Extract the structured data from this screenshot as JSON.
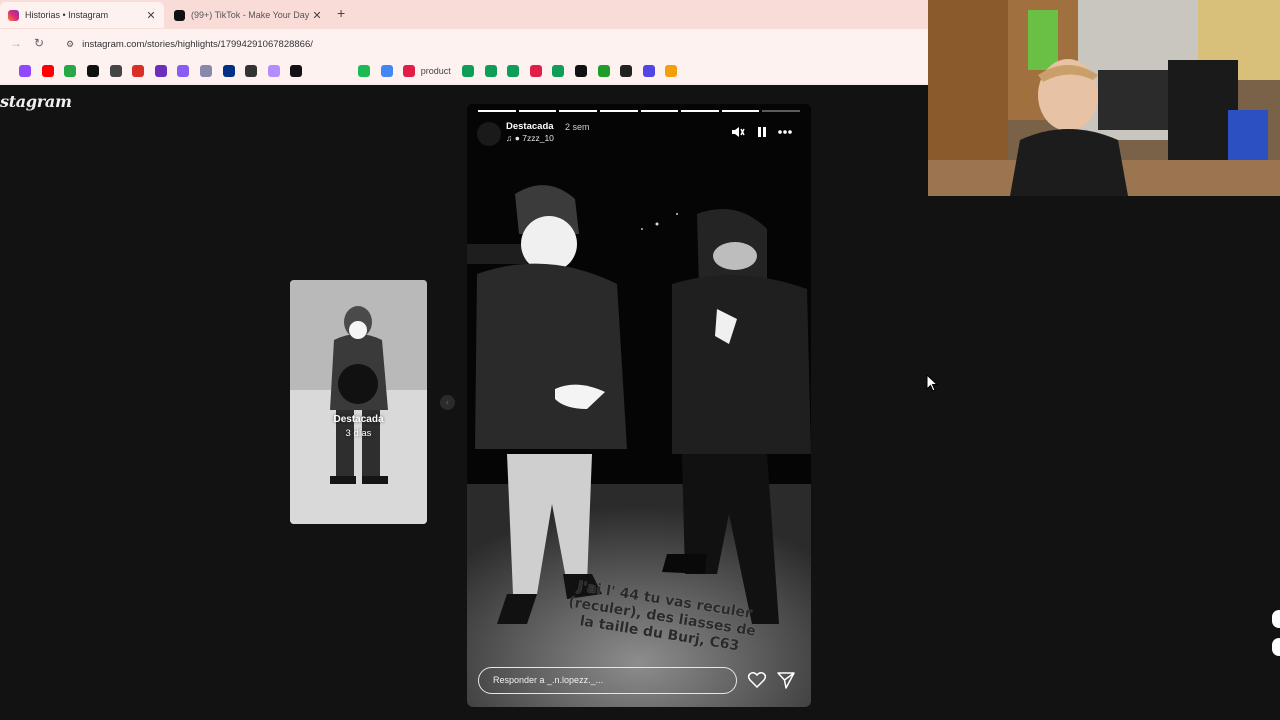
{
  "browser": {
    "tabs": [
      {
        "title": "Historias • Instagram",
        "favicon_color": "#e1306c",
        "active": true
      },
      {
        "title": "(99+) TikTok - Make Your Day",
        "favicon_color": "#111111",
        "active": false
      }
    ],
    "new_tab_icon": "plus-icon",
    "url": "instagram.com/stories/highlights/17994291067828866/",
    "bookmarks": [
      {
        "icon": "twitch",
        "color": "#9146ff"
      },
      {
        "icon": "youtube",
        "color": "#ff0000"
      },
      {
        "icon": "green-app",
        "color": "#28a745"
      },
      {
        "icon": "tiktok",
        "color": "#111111"
      },
      {
        "icon": "chatgpt",
        "color": "#444444"
      },
      {
        "icon": "gmail",
        "color": "#d93025"
      },
      {
        "icon": "purple-app",
        "color": "#6f2dbd"
      },
      {
        "icon": "rainbow-app",
        "color": "#8a5cf6"
      },
      {
        "icon": "box-app",
        "color": "#8888aa"
      },
      {
        "icon": "paypal",
        "color": "#003087"
      },
      {
        "icon": "whatsapp",
        "color": "#333333"
      },
      {
        "icon": "triangle-app",
        "color": "#b38cff"
      },
      {
        "icon": "dot-app",
        "color": "#111111"
      },
      {
        "icon": "spacer",
        "color": "#fdf2f0"
      },
      {
        "icon": "spacer",
        "color": "#fdf2f0"
      },
      {
        "icon": "spotify",
        "color": "#1db954"
      },
      {
        "icon": "play-app",
        "color": "#4285f4"
      },
      {
        "icon": "c-app",
        "color": "#e11d48"
      }
    ],
    "bookmark_label": "product",
    "bookmarks_after": [
      {
        "icon": "sheet",
        "color": "#0f9d58"
      },
      {
        "icon": "sheet",
        "color": "#0f9d58"
      },
      {
        "icon": "sheet",
        "color": "#0f9d58"
      },
      {
        "icon": "c-app",
        "color": "#e11d48"
      },
      {
        "icon": "sheet",
        "color": "#0f9d58"
      },
      {
        "icon": "github",
        "color": "#111111"
      },
      {
        "icon": "k-app",
        "color": "#1f9d2a"
      },
      {
        "icon": "s-app",
        "color": "#222222"
      },
      {
        "icon": "square-app",
        "color": "#4f46e5"
      },
      {
        "icon": "orange-app",
        "color": "#f59e0b"
      }
    ]
  },
  "instagram": {
    "logo": "stagram",
    "side_story": {
      "name": "Destacada",
      "ago": "3 días"
    },
    "story": {
      "owner": "Destacada",
      "time": "2 sem",
      "audio": "7zzz_10",
      "progress_segments": 8,
      "progress_done": 7,
      "caption": "J'ai l' 44 tu vas reculer (reculer), des liasses de la taille du Burj, C63",
      "reply_placeholder": "Responder a _.n.lopezz._..."
    }
  },
  "colors": {
    "page_bg": "#121212",
    "chrome_bg": "#fdf2f0",
    "tabstrip_bg": "#f9dcd8"
  }
}
